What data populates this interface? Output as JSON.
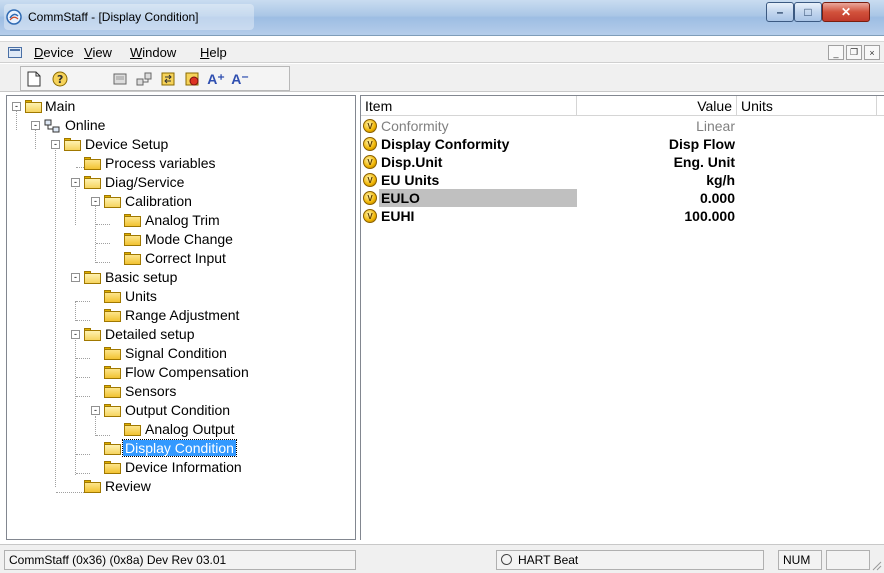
{
  "window": {
    "title": "CommStaff - [Display Condition]",
    "controls": {
      "minimize": "–",
      "maximize": "□",
      "close": "✕"
    }
  },
  "menubar": {
    "items": [
      {
        "label": "Device",
        "mnemonic": "D"
      },
      {
        "label": "View",
        "mnemonic": "V"
      },
      {
        "label": "Window",
        "mnemonic": "W"
      },
      {
        "label": "Help",
        "mnemonic": "H"
      }
    ],
    "mdi_controls": {
      "minimize": "_",
      "restore": "❐",
      "close": "×"
    }
  },
  "toolbar": {
    "buttons": [
      "new-icon",
      "help-icon",
      "device-icon",
      "network-icon",
      "transfer-icon",
      "record-icon",
      "font-increase-icon",
      "font-decrease-icon"
    ],
    "glyphs": {
      "font_increase": "A⁺",
      "font_decrease": "A⁻"
    }
  },
  "tree": {
    "nodes": [
      {
        "label": "Main"
      },
      {
        "label": "Online"
      },
      {
        "label": "Device Setup"
      },
      {
        "label": "Process variables"
      },
      {
        "label": "Diag/Service"
      },
      {
        "label": "Calibration"
      },
      {
        "label": "Analog Trim"
      },
      {
        "label": "Mode Change"
      },
      {
        "label": "Correct Input"
      },
      {
        "label": "Basic setup"
      },
      {
        "label": "Units"
      },
      {
        "label": "Range Adjustment"
      },
      {
        "label": "Detailed setup"
      },
      {
        "label": "Signal Condition"
      },
      {
        "label": "Flow Compensation"
      },
      {
        "label": "Sensors"
      },
      {
        "label": "Output Condition"
      },
      {
        "label": "Analog Output"
      },
      {
        "label": "Display Condition"
      },
      {
        "label": "Device Information"
      },
      {
        "label": "Review"
      }
    ],
    "selected": "Display Condition"
  },
  "list": {
    "columns": {
      "item": "Item",
      "value": "Value",
      "units": "Units"
    },
    "rows": [
      {
        "item": "Conformity",
        "value": "Linear",
        "units": "",
        "style": "disabled"
      },
      {
        "item": "Display Conformity",
        "value": "Disp Flow",
        "units": "",
        "style": "bold"
      },
      {
        "item": "Disp.Unit",
        "value": "Eng. Unit",
        "units": "",
        "style": "bold"
      },
      {
        "item": "EU Units",
        "value": "kg/h",
        "units": "",
        "style": "bold"
      },
      {
        "item": "EULO",
        "value": "0.000",
        "units": "",
        "style": "bold-highlight"
      },
      {
        "item": "EUHI",
        "value": "100.000",
        "units": "",
        "style": "bold"
      }
    ],
    "row_icon_glyph": "V"
  },
  "statusbar": {
    "device_info": "CommStaff  (0x36)  (0x8a) Dev Rev 03.01",
    "hart_beat": "HART Beat",
    "num": "NUM"
  },
  "colors": {
    "selection": "#3399ff",
    "highlight_row": "#c0c0c0",
    "folder": "#f1c232"
  }
}
